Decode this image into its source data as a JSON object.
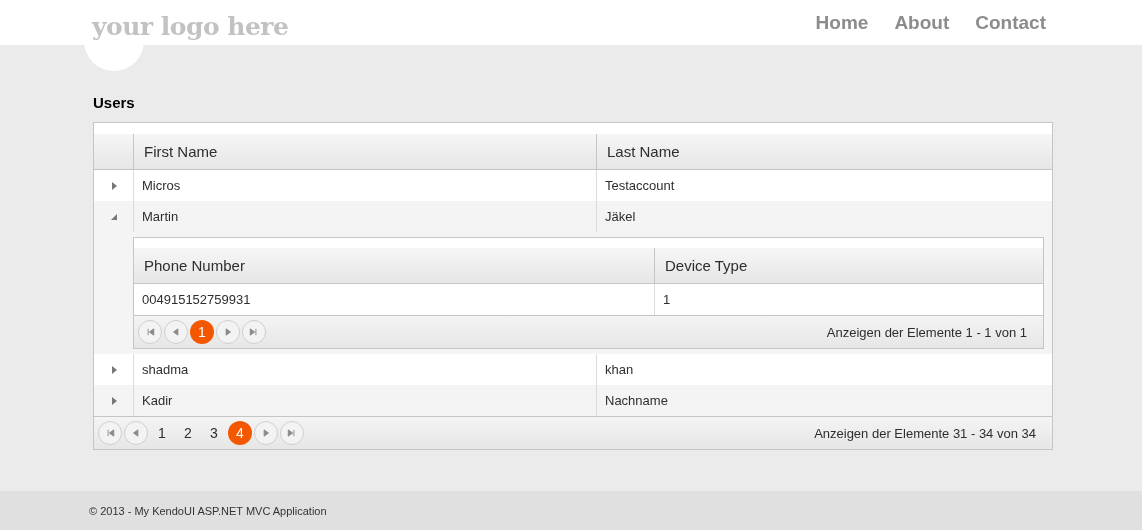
{
  "header": {
    "logo": "your logo here",
    "nav": [
      "Home",
      "About",
      "Contact"
    ]
  },
  "title": "Users",
  "grid": {
    "columns": [
      "First Name",
      "Last Name"
    ],
    "rows": [
      {
        "first": "Micros",
        "last": "Testaccount",
        "expanded": false
      },
      {
        "first": "Martin",
        "last": "Jäkel",
        "expanded": true,
        "detail": {
          "columns": [
            "Phone Number",
            "Device Type"
          ],
          "rows": [
            [
              "004915152759931",
              "1"
            ]
          ],
          "pager": {
            "pages": [
              {
                "label": "1",
                "selected": true
              }
            ],
            "info": "Anzeigen der Elemente 1 - 1 von 1"
          }
        }
      },
      {
        "first": "shadma",
        "last": "khan",
        "expanded": false
      },
      {
        "first": "Kadir",
        "last": "Nachname",
        "expanded": false
      }
    ],
    "pager": {
      "pages": [
        {
          "label": "1",
          "selected": false
        },
        {
          "label": "2",
          "selected": false
        },
        {
          "label": "3",
          "selected": false
        },
        {
          "label": "4",
          "selected": true
        }
      ],
      "info": "Anzeigen der Elemente 31 - 34 von 34"
    }
  },
  "footer": "© 2013 - My KendoUI ASP.NET MVC Application"
}
